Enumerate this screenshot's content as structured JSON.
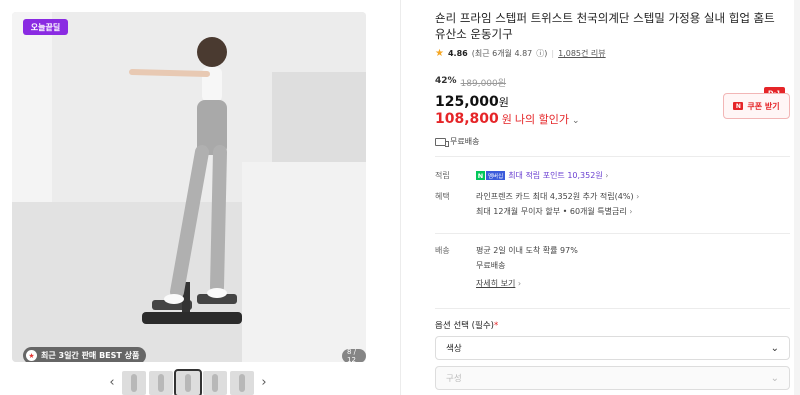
{
  "gallery": {
    "badge": "오늘끝딜",
    "bestseller": "최근 3일간 판매 BEST 상품",
    "counter": "8 / 12",
    "thumbs_count": 6,
    "active_thumb": 3
  },
  "product": {
    "title": "숀리 프라임 스텝퍼 트위스트 천국의계단 스텝밀 가정용 실내 힙업 홈트 유산소 운동기구",
    "rating": "4.86",
    "rating_detail": "(최근 6개월 4.87",
    "reviews": "1,085건 리뷰",
    "discount_pct": "42%",
    "original_price": "189,000원",
    "price": "125,000",
    "price_unit": "원",
    "my_price": "108,800",
    "my_price_unit": "원",
    "my_price_label": "나의 할인가",
    "coupon_label": "쿠폰 받기",
    "coupon_tag": "D-1",
    "free_ship": "무료배송"
  },
  "info": {
    "point_key": "적립",
    "point_text": "최대 적립 포인트 10,352원",
    "benefit_key": "혜택",
    "benefit_1": "라인프렌즈 카드 최대 4,352원 추가 적립(4%)",
    "benefit_2": "최대 12개월 무이자 할부 • 60개월 특별금리",
    "delivery_key": "배송",
    "delivery_1": "평균 2일 이내 도착 확률 97%",
    "delivery_2": "무료배송",
    "delivery_more": "자세히 보기"
  },
  "options": {
    "label": "옵션 선택 (필수)",
    "required_mark": "*",
    "select_1": "색상",
    "select_2": "구성"
  },
  "colors": {
    "accent_red": "#e52528",
    "badge_purple": "#8a2be2",
    "naver_green": "#03c75a"
  }
}
